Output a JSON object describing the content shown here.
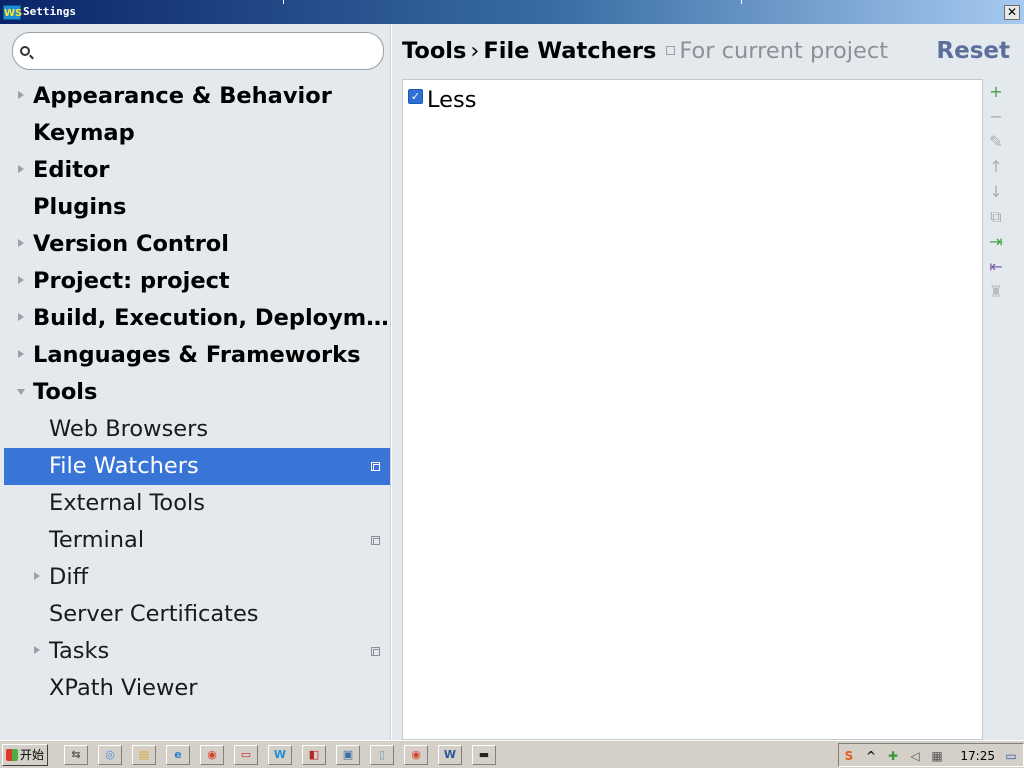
{
  "window": {
    "title": "Settings",
    "logo_text": "WS",
    "close_glyph": "✕"
  },
  "search": {
    "placeholder": "",
    "value": ""
  },
  "tree": [
    {
      "label": "Appearance & Behavior",
      "level": 0,
      "expandable": true,
      "expanded": false,
      "project_scope": false,
      "selected": false
    },
    {
      "label": "Keymap",
      "level": 0,
      "expandable": false,
      "expanded": false,
      "project_scope": false,
      "selected": false
    },
    {
      "label": "Editor",
      "level": 0,
      "expandable": true,
      "expanded": false,
      "project_scope": false,
      "selected": false
    },
    {
      "label": "Plugins",
      "level": 0,
      "expandable": false,
      "expanded": false,
      "project_scope": false,
      "selected": false
    },
    {
      "label": "Version Control",
      "level": 0,
      "expandable": true,
      "expanded": false,
      "project_scope": false,
      "selected": false
    },
    {
      "label": "Project: project",
      "level": 0,
      "expandable": true,
      "expanded": false,
      "project_scope": false,
      "selected": false
    },
    {
      "label": "Build, Execution, Deploym…",
      "level": 0,
      "expandable": true,
      "expanded": false,
      "project_scope": false,
      "selected": false
    },
    {
      "label": "Languages & Frameworks",
      "level": 0,
      "expandable": true,
      "expanded": false,
      "project_scope": false,
      "selected": false
    },
    {
      "label": "Tools",
      "level": 0,
      "expandable": true,
      "expanded": true,
      "project_scope": false,
      "selected": false
    },
    {
      "label": "Web Browsers",
      "level": 1,
      "expandable": false,
      "expanded": false,
      "project_scope": false,
      "selected": false
    },
    {
      "label": "File Watchers",
      "level": 1,
      "expandable": false,
      "expanded": false,
      "project_scope": true,
      "selected": true
    },
    {
      "label": "External Tools",
      "level": 1,
      "expandable": false,
      "expanded": false,
      "project_scope": false,
      "selected": false
    },
    {
      "label": "Terminal",
      "level": 1,
      "expandable": false,
      "expanded": false,
      "project_scope": true,
      "selected": false
    },
    {
      "label": "Diff",
      "level": 1,
      "expandable": true,
      "expanded": false,
      "project_scope": false,
      "selected": false
    },
    {
      "label": "Server Certificates",
      "level": 1,
      "expandable": false,
      "expanded": false,
      "project_scope": false,
      "selected": false
    },
    {
      "label": "Tasks",
      "level": 1,
      "expandable": true,
      "expanded": false,
      "project_scope": true,
      "selected": false
    },
    {
      "label": "XPath Viewer",
      "level": 1,
      "expandable": false,
      "expanded": false,
      "project_scope": false,
      "selected": false
    }
  ],
  "header": {
    "crumb_parent": "Tools",
    "separator": "›",
    "crumb_current": "File Watchers",
    "scope_text": "For current project",
    "reset_label": "Reset"
  },
  "watchers": [
    {
      "label": "Less",
      "checked": true
    }
  ],
  "toolbar": [
    {
      "name": "add-icon",
      "glyph": "+",
      "color": "#3fa33f",
      "enabled": true
    },
    {
      "name": "remove-icon",
      "glyph": "−",
      "color": "#a8adb2",
      "enabled": false
    },
    {
      "name": "edit-icon",
      "glyph": "✎",
      "color": "#a8adb2",
      "enabled": false
    },
    {
      "name": "move-up-icon",
      "glyph": "↑",
      "color": "#a8adb2",
      "enabled": false
    },
    {
      "name": "move-down-icon",
      "glyph": "↓",
      "color": "#a8adb2",
      "enabled": false
    },
    {
      "name": "copy-icon",
      "glyph": "⧉",
      "color": "#a8adb2",
      "enabled": false
    },
    {
      "name": "import-icon",
      "glyph": "⇥",
      "color": "#3fa33f",
      "enabled": true
    },
    {
      "name": "export-icon",
      "glyph": "⇤",
      "color": "#7b5ea8",
      "enabled": true
    },
    {
      "name": "stamp-icon",
      "glyph": "♜",
      "color": "#b9bdc1",
      "enabled": false
    }
  ],
  "taskbar": {
    "start_label": "开始",
    "apps": [
      {
        "name": "task-switch-icon",
        "glyph": "⇆",
        "color": "#555555"
      },
      {
        "name": "browser-app-icon",
        "glyph": "◎",
        "color": "#4a90d9"
      },
      {
        "name": "explorer-app-icon",
        "glyph": "▤",
        "color": "#d9a43a"
      },
      {
        "name": "ie-app-icon",
        "glyph": "e",
        "color": "#2f7fd1"
      },
      {
        "name": "chrome-app-icon",
        "glyph": "◉",
        "color": "#d8452d"
      },
      {
        "name": "media-app-icon",
        "glyph": "▭",
        "color": "#c62828"
      },
      {
        "name": "webstorm-app-icon",
        "glyph": "W",
        "color": "#1f8fd6"
      },
      {
        "name": "gallery-app-icon",
        "glyph": "◧",
        "color": "#b3262a"
      },
      {
        "name": "window-app-icon",
        "glyph": "▣",
        "color": "#3a6ea5"
      },
      {
        "name": "notepad-app-icon",
        "glyph": "▯",
        "color": "#6fa0c9"
      },
      {
        "name": "chrome2-app-icon",
        "glyph": "◉",
        "color": "#d8452d"
      },
      {
        "name": "word-app-icon",
        "glyph": "W",
        "color": "#2b579a"
      },
      {
        "name": "cmd-app-icon",
        "glyph": "▬",
        "color": "#222222"
      }
    ],
    "tray": [
      {
        "name": "ime-icon",
        "glyph": "S",
        "color": "#e65b1a"
      },
      {
        "name": "expand-tray-icon",
        "glyph": "^",
        "color": "#222222"
      },
      {
        "name": "update-icon",
        "glyph": "✚",
        "color": "#3a9a3a"
      },
      {
        "name": "volume-icon",
        "glyph": "◁",
        "color": "#555555"
      },
      {
        "name": "network-icon",
        "glyph": "▦",
        "color": "#555555"
      }
    ],
    "clock": "17:25",
    "desktop_icon": "▭"
  }
}
